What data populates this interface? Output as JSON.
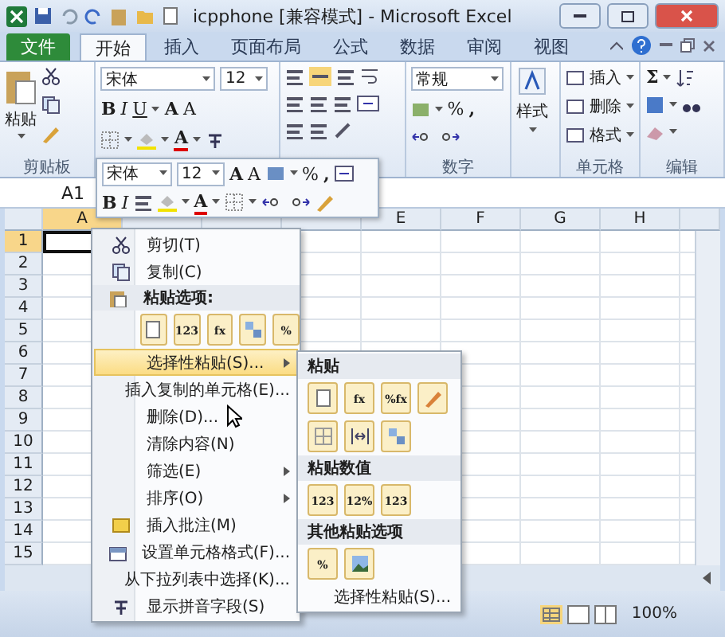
{
  "window": {
    "title": "icpphone  [兼容模式]  -  Microsoft Excel"
  },
  "ribbon_tabs": [
    {
      "label": "文件",
      "kind": "file",
      "selected": false
    },
    {
      "label": "开始",
      "kind": "tab",
      "selected": true
    },
    {
      "label": "插入",
      "kind": "tab",
      "selected": false
    },
    {
      "label": "页面布局",
      "kind": "tab",
      "selected": false
    },
    {
      "label": "公式",
      "kind": "tab",
      "selected": false
    },
    {
      "label": "数据",
      "kind": "tab",
      "selected": false
    },
    {
      "label": "审阅",
      "kind": "tab",
      "selected": false
    },
    {
      "label": "视图",
      "kind": "tab",
      "selected": false
    }
  ],
  "ribbon": {
    "clipboard": {
      "paste": "粘贴",
      "label": "剪贴板"
    },
    "font": {
      "font_name": "宋体",
      "font_size": "12",
      "bold": "B",
      "italic": "I",
      "underline": "U",
      "grow": "A",
      "shrink": "A",
      "font_color": "A"
    },
    "number": {
      "format": "常规",
      "percent": "%",
      "comma": ",",
      "label": "数字"
    },
    "styles": {
      "button": "样式"
    },
    "cells": {
      "items": [
        "插入",
        "删除",
        "格式"
      ],
      "label": "单元格"
    },
    "editing": {
      "sum": "Σ",
      "label": "编辑"
    }
  },
  "formula_bar": {
    "name_box": "A1"
  },
  "columns": [
    {
      "label": "A",
      "selected": true
    },
    {
      "selected": false
    },
    {
      "selected": false
    },
    {
      "selected": false
    },
    {
      "label": "E",
      "selected": false
    },
    {
      "label": "F",
      "selected": false
    },
    {
      "label": "G",
      "selected": false
    },
    {
      "label": "H",
      "selected": false
    }
  ],
  "rows": [
    {
      "label": "1",
      "selected": true
    },
    {
      "label": "2",
      "selected": false
    },
    {
      "label": "3",
      "selected": false
    },
    {
      "label": "4",
      "selected": false
    },
    {
      "label": "5",
      "selected": false
    },
    {
      "label": "6",
      "selected": false
    },
    {
      "label": "7",
      "selected": false
    },
    {
      "label": "8",
      "selected": false
    },
    {
      "label": "9",
      "selected": false
    },
    {
      "label": "10",
      "selected": false
    },
    {
      "label": "11",
      "selected": false
    },
    {
      "label": "12",
      "selected": false
    },
    {
      "label": "13",
      "selected": false
    },
    {
      "label": "14",
      "selected": false
    },
    {
      "label": "15",
      "selected": false
    }
  ],
  "status_bar": {
    "zoom": "100%"
  },
  "mini_toolbar": {
    "font_name": "宋体",
    "font_size": "12",
    "grow": "A",
    "shrink": "A",
    "percent": "%",
    "comma": ",",
    "bold": "B",
    "italic": "I",
    "font_color": "A"
  },
  "context_menu": [
    {
      "kind": "item",
      "label": "剪切(T)",
      "selected": false,
      "submenu": false
    },
    {
      "kind": "item",
      "label": "复制(C)",
      "selected": false,
      "submenu": false
    },
    {
      "kind": "header",
      "label": "粘贴选项:"
    },
    {
      "kind": "icons",
      "icons": [
        {
          "kind": "doc"
        },
        {
          "kind": "glyph",
          "glyph": "123"
        },
        {
          "kind": "glyph",
          "glyph": "fx"
        },
        {
          "kind": "transpose"
        },
        {
          "kind": "glyph",
          "glyph": "%"
        }
      ]
    },
    {
      "kind": "item",
      "label": "选择性粘贴(S)...",
      "selected": true,
      "submenu": true
    },
    {
      "kind": "item",
      "label": "插入复制的单元格(E)...",
      "selected": false,
      "submenu": false
    },
    {
      "kind": "item",
      "label": "删除(D)...",
      "selected": false,
      "submenu": false
    },
    {
      "kind": "item",
      "label": "清除内容(N)",
      "selected": false,
      "submenu": false
    },
    {
      "kind": "item",
      "label": "筛选(E)",
      "selected": false,
      "submenu": true
    },
    {
      "kind": "item",
      "label": "排序(O)",
      "selected": false,
      "submenu": true
    },
    {
      "kind": "item",
      "label": "插入批注(M)",
      "selected": false,
      "submenu": false
    },
    {
      "kind": "item",
      "label": "设置单元格格式(F)...",
      "selected": false,
      "submenu": false
    },
    {
      "kind": "item",
      "label": "从下拉列表中选择(K)...",
      "selected": false,
      "submenu": false
    },
    {
      "kind": "item",
      "label": "显示拼音字段(S)",
      "selected": false,
      "submenu": false
    }
  ],
  "paste_submenu": [
    {
      "kind": "header",
      "label": "粘贴"
    },
    {
      "kind": "icons",
      "icons": [
        {
          "kind": "doc"
        },
        {
          "kind": "glyph",
          "glyph": "fx"
        },
        {
          "kind": "glyph",
          "glyph": "%fx"
        },
        {
          "kind": "brush"
        }
      ]
    },
    {
      "kind": "icons",
      "icons": [
        {
          "kind": "grid"
        },
        {
          "kind": "widths"
        },
        {
          "kind": "transpose"
        }
      ]
    },
    {
      "kind": "header",
      "label": "粘贴数值"
    },
    {
      "kind": "icons",
      "icons": [
        {
          "kind": "glyph",
          "glyph": "123"
        },
        {
          "kind": "glyph",
          "glyph": "12%"
        },
        {
          "kind": "glyph",
          "glyph": "123"
        }
      ]
    },
    {
      "kind": "header",
      "label": "其他粘贴选项"
    },
    {
      "kind": "icons",
      "icons": [
        {
          "kind": "glyph",
          "glyph": "%"
        },
        {
          "kind": "picture"
        }
      ]
    },
    {
      "kind": "item",
      "label": "选择性粘贴(S)...",
      "selected": false,
      "submenu": false
    }
  ]
}
